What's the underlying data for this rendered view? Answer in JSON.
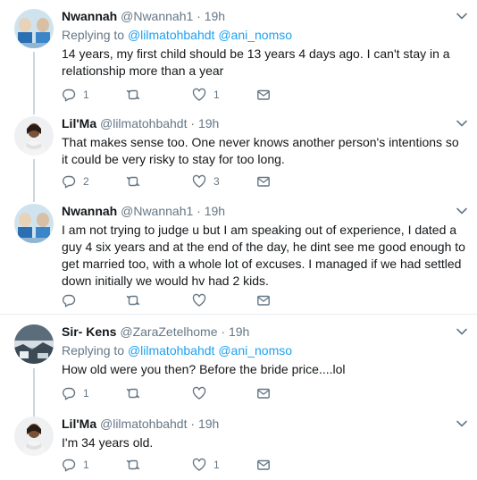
{
  "tweets": [
    {
      "name": "Nwannah",
      "handle": "@Nwannah1",
      "dot": "·",
      "time": "19h",
      "replying_label": "Replying to",
      "replying_to": [
        "@lilmatohbahdt",
        "@ani_nomso"
      ],
      "text": "14 years, my first child should be 13 years 4 days ago. I can't stay in a relationship more than a year",
      "reply_count": "1",
      "retweet_count": "",
      "like_count": "1"
    },
    {
      "name": "Lil'Ma",
      "handle": "@lilmatohbahdt",
      "dot": "·",
      "time": "19h",
      "text": "That makes sense too. One never knows another person's intentions so it could be very risky to stay for too long.",
      "reply_count": "2",
      "retweet_count": "",
      "like_count": "3"
    },
    {
      "name": "Nwannah",
      "handle": "@Nwannah1",
      "dot": "·",
      "time": "19h",
      "text": "I am not trying to judge u but I am speaking out of experience, I dated a guy 4 six years and at the end of the day, he dint see me good enough to get married too, with a whole lot of excuses. I managed if we had settled down initially we would hv had 2 kids.",
      "reply_count": "",
      "retweet_count": "",
      "like_count": ""
    },
    {
      "name": "Sir- Kens",
      "handle": "@ZaraZetelhome",
      "dot": "·",
      "time": "19h",
      "replying_label": "Replying to",
      "replying_to": [
        "@lilmatohbahdt",
        "@ani_nomso"
      ],
      "text": "How old were you then? Before the bride price....lol",
      "reply_count": "1",
      "retweet_count": "",
      "like_count": ""
    },
    {
      "name": "Lil'Ma",
      "handle": "@lilmatohbahdt",
      "dot": "·",
      "time": "19h",
      "text": "I'm 34 years old.",
      "reply_count": "1",
      "retweet_count": "",
      "like_count": "1"
    }
  ],
  "icons": {
    "reply": "reply-icon",
    "retweet": "retweet-icon",
    "like": "heart-icon",
    "message": "envelope-icon",
    "caret": "chevron-down-icon"
  },
  "colors": {
    "link": "#1da1f2",
    "secondary_text": "#657786",
    "primary_text": "#14171a",
    "thread_line": "#ccd6dd",
    "divider": "#e6ecf0"
  }
}
